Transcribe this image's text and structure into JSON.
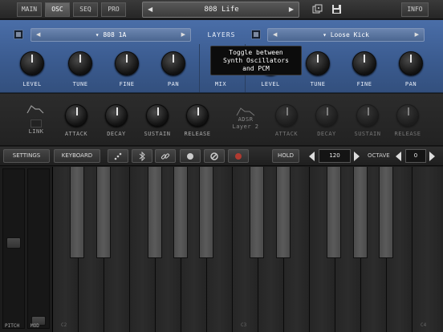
{
  "topbar": {
    "tabs": [
      "MAIN",
      "OSC",
      "SEQ",
      "PRO"
    ],
    "active_tab": "OSC",
    "preset_name": "808 Life",
    "info_label": "INFO"
  },
  "layers": {
    "title": "LAYERS",
    "layer1": {
      "sound": "808 1A",
      "knobs": [
        "LEVEL",
        "TUNE",
        "FINE",
        "PAN"
      ]
    },
    "layer2": {
      "sound": "Loose Kick",
      "knobs": [
        "LEVEL",
        "TUNE",
        "FINE",
        "PAN"
      ]
    },
    "mix_label": "MIX"
  },
  "tooltip": {
    "line1": "Toggle between",
    "line2": "Synth Oscillators",
    "line3": "and PCM"
  },
  "adsr": {
    "link_label": "LINK",
    "layer1_knobs": [
      "ATTACK",
      "DECAY",
      "SUSTAIN",
      "RELEASE"
    ],
    "layer2_title": "ADSR",
    "layer2_subtitle": "Layer 2",
    "layer2_knobs": [
      "ATTACK",
      "DECAY",
      "SUSTAIN",
      "RELEASE"
    ]
  },
  "toolbar": {
    "settings_label": "SETTINGS",
    "keyboard_label": "KEYBOARD",
    "hold_label": "HOLD",
    "tempo_value": "120",
    "octave_label": "OCTAVE",
    "octave_value": "0"
  },
  "keyboard": {
    "pitch_label": "PITCH",
    "mod_label": "MOD",
    "note_labels": [
      "C2",
      "C3",
      "C4"
    ]
  },
  "colors": {
    "accent_panel": "#3e5f96",
    "record": "#c0392b"
  }
}
